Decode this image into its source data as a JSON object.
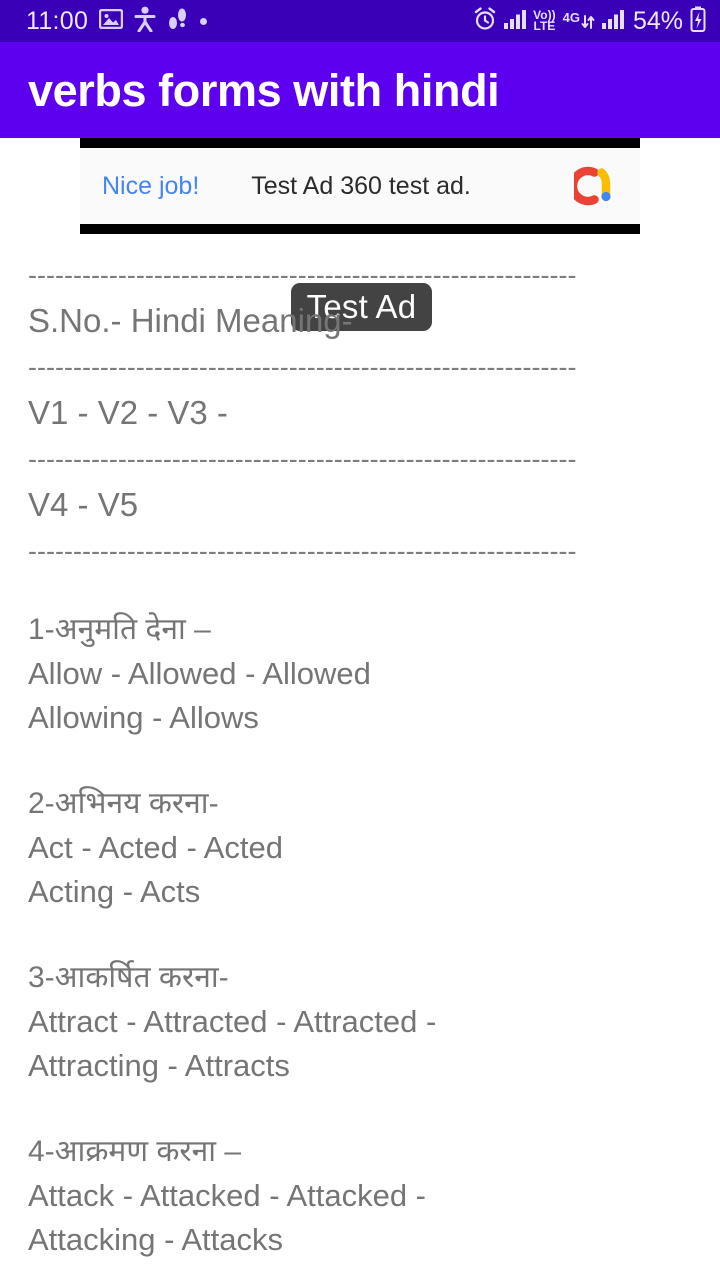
{
  "statusbar": {
    "time": "11:00",
    "battery_percent": "54%",
    "volte_top": "Vo))",
    "volte_bottom": "LTE",
    "network": "4G",
    "icons": [
      "image-icon",
      "accessibility-icon",
      "footsteps-icon",
      "dot-icon",
      "alarm-icon",
      "signal-bars-icon",
      "volte-icon",
      "data-arrows-icon",
      "signal-bars-2-icon",
      "battery-charging-icon"
    ],
    "bg_color": "#3a00b8",
    "fg_color": "#eee8fd"
  },
  "appbar": {
    "title": "verbs forms with hindi",
    "bg_color": "#5e00f0",
    "title_color": "#ffffff"
  },
  "ad": {
    "cta_label": "Nice job!",
    "body_text": "Test Ad 360 test ad.",
    "overlay_label": "Test Ad",
    "logo_name": "admob-logo",
    "cta_color": "#4285f4",
    "overlay_bg": "#434343"
  },
  "content": {
    "text_color": "#757575",
    "separator": "-------------------------------------------------------------",
    "header_lines": [
      "S.No.- Hindi Meaning-",
      "V1 - V2 - V3 -",
      "V4 - V5"
    ],
    "entries": [
      {
        "hindi": "1-अनुमति देना –",
        "forms_1": "Allow - Allowed - Allowed",
        "forms_2": "Allowing - Allows"
      },
      {
        "hindi": "2-अभिनय करना-",
        "forms_1": "Act - Acted - Acted",
        "forms_2": "Acting - Acts"
      },
      {
        "hindi": "3-आकर्षित करना-",
        "forms_1": "Attract - Attracted - Attracted -",
        "forms_2": "Attracting - Attracts"
      },
      {
        "hindi": "4-आक्रमण करना –",
        "forms_1": "Attack - Attacked - Attacked -",
        "forms_2": "Attacking - Attacks"
      }
    ]
  }
}
